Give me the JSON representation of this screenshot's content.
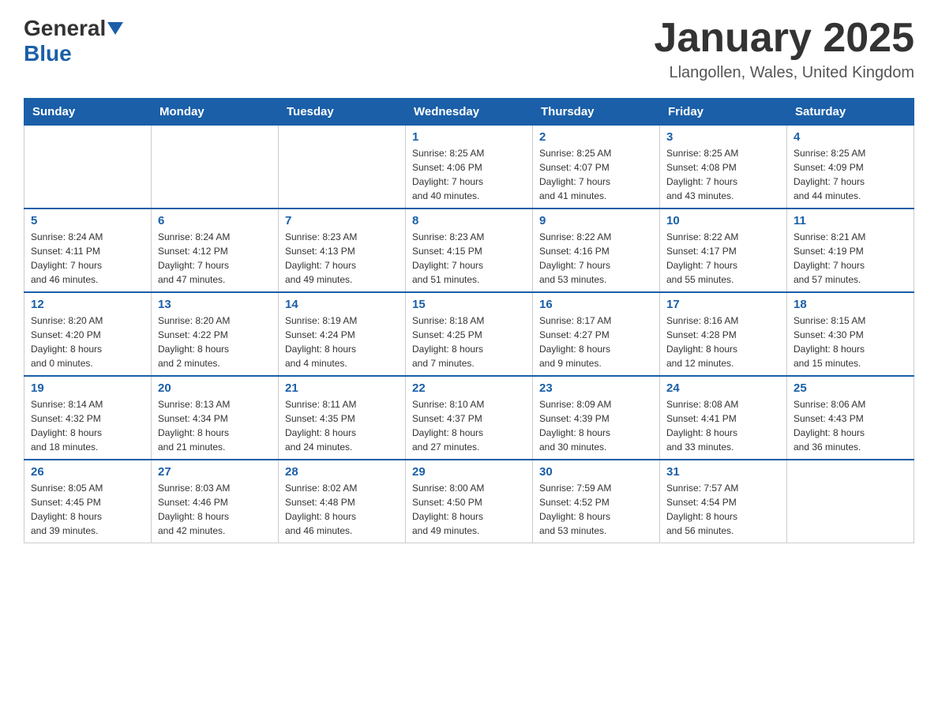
{
  "header": {
    "logo_general": "General",
    "logo_blue": "Blue",
    "month_title": "January 2025",
    "location": "Llangollen, Wales, United Kingdom"
  },
  "days_of_week": [
    "Sunday",
    "Monday",
    "Tuesday",
    "Wednesday",
    "Thursday",
    "Friday",
    "Saturday"
  ],
  "weeks": [
    [
      {
        "day": "",
        "info": ""
      },
      {
        "day": "",
        "info": ""
      },
      {
        "day": "",
        "info": ""
      },
      {
        "day": "1",
        "info": "Sunrise: 8:25 AM\nSunset: 4:06 PM\nDaylight: 7 hours\nand 40 minutes."
      },
      {
        "day": "2",
        "info": "Sunrise: 8:25 AM\nSunset: 4:07 PM\nDaylight: 7 hours\nand 41 minutes."
      },
      {
        "day": "3",
        "info": "Sunrise: 8:25 AM\nSunset: 4:08 PM\nDaylight: 7 hours\nand 43 minutes."
      },
      {
        "day": "4",
        "info": "Sunrise: 8:25 AM\nSunset: 4:09 PM\nDaylight: 7 hours\nand 44 minutes."
      }
    ],
    [
      {
        "day": "5",
        "info": "Sunrise: 8:24 AM\nSunset: 4:11 PM\nDaylight: 7 hours\nand 46 minutes."
      },
      {
        "day": "6",
        "info": "Sunrise: 8:24 AM\nSunset: 4:12 PM\nDaylight: 7 hours\nand 47 minutes."
      },
      {
        "day": "7",
        "info": "Sunrise: 8:23 AM\nSunset: 4:13 PM\nDaylight: 7 hours\nand 49 minutes."
      },
      {
        "day": "8",
        "info": "Sunrise: 8:23 AM\nSunset: 4:15 PM\nDaylight: 7 hours\nand 51 minutes."
      },
      {
        "day": "9",
        "info": "Sunrise: 8:22 AM\nSunset: 4:16 PM\nDaylight: 7 hours\nand 53 minutes."
      },
      {
        "day": "10",
        "info": "Sunrise: 8:22 AM\nSunset: 4:17 PM\nDaylight: 7 hours\nand 55 minutes."
      },
      {
        "day": "11",
        "info": "Sunrise: 8:21 AM\nSunset: 4:19 PM\nDaylight: 7 hours\nand 57 minutes."
      }
    ],
    [
      {
        "day": "12",
        "info": "Sunrise: 8:20 AM\nSunset: 4:20 PM\nDaylight: 8 hours\nand 0 minutes."
      },
      {
        "day": "13",
        "info": "Sunrise: 8:20 AM\nSunset: 4:22 PM\nDaylight: 8 hours\nand 2 minutes."
      },
      {
        "day": "14",
        "info": "Sunrise: 8:19 AM\nSunset: 4:24 PM\nDaylight: 8 hours\nand 4 minutes."
      },
      {
        "day": "15",
        "info": "Sunrise: 8:18 AM\nSunset: 4:25 PM\nDaylight: 8 hours\nand 7 minutes."
      },
      {
        "day": "16",
        "info": "Sunrise: 8:17 AM\nSunset: 4:27 PM\nDaylight: 8 hours\nand 9 minutes."
      },
      {
        "day": "17",
        "info": "Sunrise: 8:16 AM\nSunset: 4:28 PM\nDaylight: 8 hours\nand 12 minutes."
      },
      {
        "day": "18",
        "info": "Sunrise: 8:15 AM\nSunset: 4:30 PM\nDaylight: 8 hours\nand 15 minutes."
      }
    ],
    [
      {
        "day": "19",
        "info": "Sunrise: 8:14 AM\nSunset: 4:32 PM\nDaylight: 8 hours\nand 18 minutes."
      },
      {
        "day": "20",
        "info": "Sunrise: 8:13 AM\nSunset: 4:34 PM\nDaylight: 8 hours\nand 21 minutes."
      },
      {
        "day": "21",
        "info": "Sunrise: 8:11 AM\nSunset: 4:35 PM\nDaylight: 8 hours\nand 24 minutes."
      },
      {
        "day": "22",
        "info": "Sunrise: 8:10 AM\nSunset: 4:37 PM\nDaylight: 8 hours\nand 27 minutes."
      },
      {
        "day": "23",
        "info": "Sunrise: 8:09 AM\nSunset: 4:39 PM\nDaylight: 8 hours\nand 30 minutes."
      },
      {
        "day": "24",
        "info": "Sunrise: 8:08 AM\nSunset: 4:41 PM\nDaylight: 8 hours\nand 33 minutes."
      },
      {
        "day": "25",
        "info": "Sunrise: 8:06 AM\nSunset: 4:43 PM\nDaylight: 8 hours\nand 36 minutes."
      }
    ],
    [
      {
        "day": "26",
        "info": "Sunrise: 8:05 AM\nSunset: 4:45 PM\nDaylight: 8 hours\nand 39 minutes."
      },
      {
        "day": "27",
        "info": "Sunrise: 8:03 AM\nSunset: 4:46 PM\nDaylight: 8 hours\nand 42 minutes."
      },
      {
        "day": "28",
        "info": "Sunrise: 8:02 AM\nSunset: 4:48 PM\nDaylight: 8 hours\nand 46 minutes."
      },
      {
        "day": "29",
        "info": "Sunrise: 8:00 AM\nSunset: 4:50 PM\nDaylight: 8 hours\nand 49 minutes."
      },
      {
        "day": "30",
        "info": "Sunrise: 7:59 AM\nSunset: 4:52 PM\nDaylight: 8 hours\nand 53 minutes."
      },
      {
        "day": "31",
        "info": "Sunrise: 7:57 AM\nSunset: 4:54 PM\nDaylight: 8 hours\nand 56 minutes."
      },
      {
        "day": "",
        "info": ""
      }
    ]
  ]
}
